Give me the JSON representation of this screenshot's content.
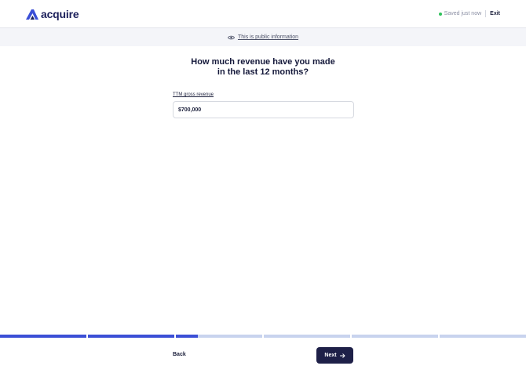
{
  "header": {
    "brand": "acquire",
    "status_text": "Saved just now",
    "exit_label": "Exit",
    "brand_color": "#3b4fd6",
    "status_color": "#2fc25b"
  },
  "banner": {
    "text": "This is public information",
    "icon": "eye-icon"
  },
  "question": {
    "line1": "How much revenue have you made",
    "line2": "in the last 12 months?"
  },
  "field": {
    "label": "TTM gross revenue",
    "value": "$700,000"
  },
  "progress": {
    "segments": [
      1,
      1,
      0.25,
      0,
      0,
      0
    ],
    "fill_color": "#3b4fd6",
    "track_color": "#c8d3ee"
  },
  "footer": {
    "back_label": "Back",
    "next_label": "Next",
    "next_icon": "arrow-right-icon"
  }
}
